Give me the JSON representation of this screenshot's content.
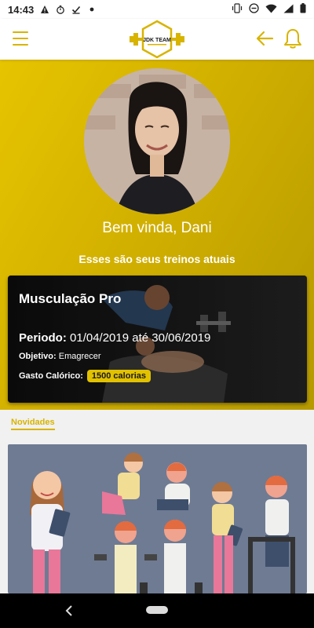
{
  "status_bar": {
    "time": "14:43",
    "icons": [
      "warning-icon",
      "stopwatch-icon",
      "checkmark-icon",
      "dot-icon"
    ],
    "right_icons": [
      "vibrate-icon",
      "do-not-disturb-icon",
      "wifi-icon",
      "signal-icon",
      "battery-icon"
    ]
  },
  "app_bar": {
    "logo_text": "JDK TEAM",
    "icons": {
      "menu": "menu-icon",
      "back": "arrow-left-icon",
      "notifications": "bell-icon"
    }
  },
  "hero": {
    "welcome": "Bem vinda, Dani",
    "subtitle": "Esses são seus treinos atuais"
  },
  "workout": {
    "title": "Musculação Pro",
    "period_label": "Periodo:",
    "period_value": "01/04/2019 até 30/06/2019",
    "goal_label": "Objetivo:",
    "goal_value": "Emagrecer",
    "calories_label": "Gasto Calórico:",
    "calories_value": "1500 calorias"
  },
  "news": {
    "label": "Novidades"
  },
  "colors": {
    "accent": "#d8b400",
    "hero_gradient_start": "#e6c400",
    "hero_gradient_end": "#b59a00",
    "news_bg": "#6f7b93",
    "badge": "#e2c200"
  }
}
